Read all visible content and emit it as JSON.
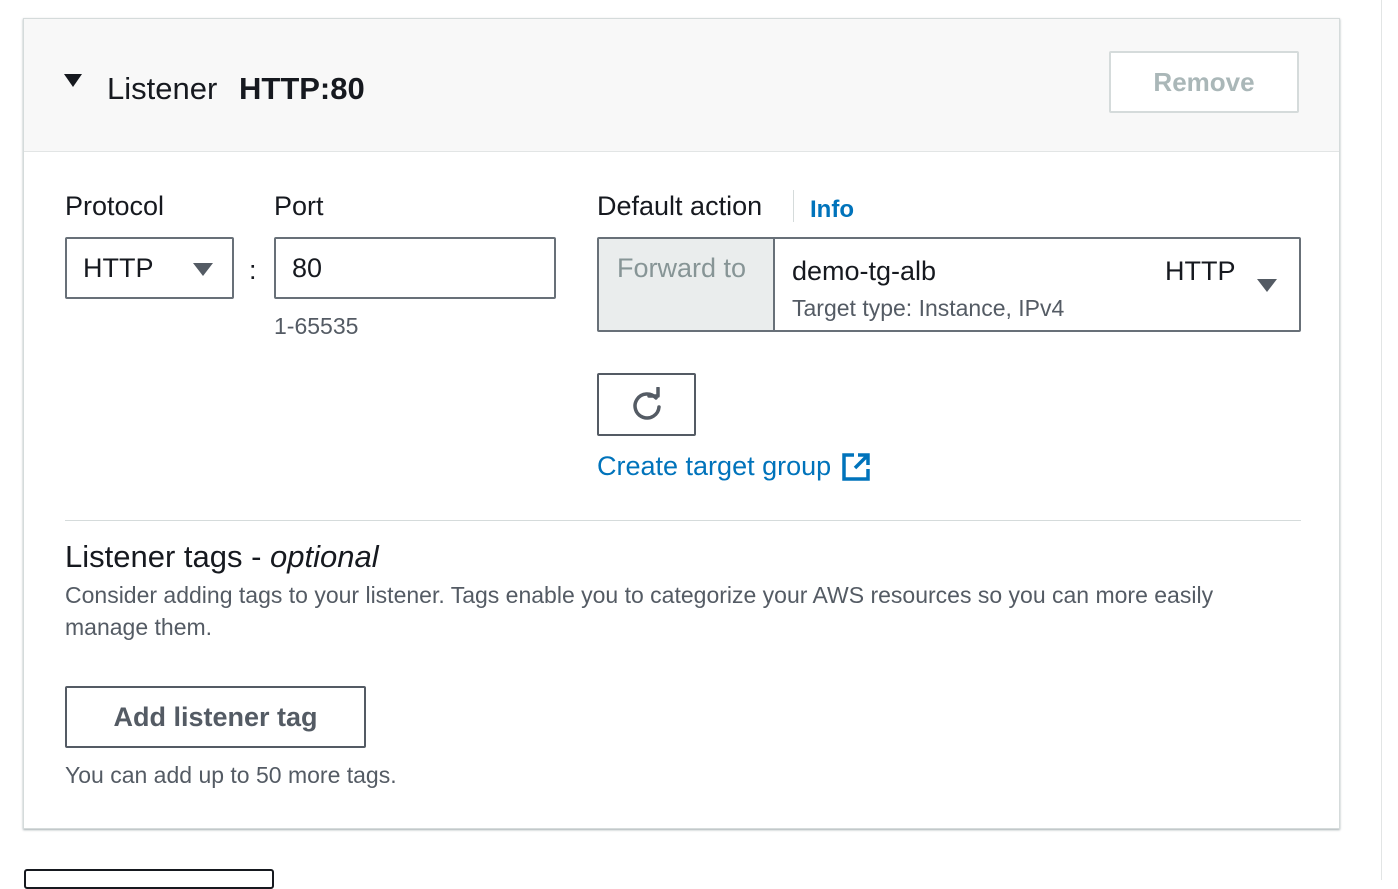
{
  "listener": {
    "label": "Listener",
    "value": "HTTP:80",
    "remove_label": "Remove"
  },
  "protocol": {
    "label": "Protocol",
    "value": "HTTP"
  },
  "port": {
    "label": "Port",
    "value": "80",
    "separator": ":",
    "hint": "1-65535"
  },
  "default_action": {
    "label": "Default action",
    "info_label": "Info",
    "forward_label": "Forward to",
    "target_group_name": "demo-tg-alb",
    "target_group_protocol": "HTTP",
    "target_group_desc": "Target type: Instance, IPv4",
    "create_link": "Create target group"
  },
  "tags": {
    "title": "Listener tags - ",
    "title_optional": "optional",
    "description": "Consider adding tags to your listener. Tags enable you to categorize your AWS resources so you can more easily manage them.",
    "add_label": "Add listener tag",
    "hint": "You can add up to 50 more tags."
  },
  "colors": {
    "link": "#0073bb",
    "border": "#687078",
    "disabled_text": "#aab7b8"
  },
  "icons": {
    "collapse": "caret-down-icon",
    "dropdown": "triangle-down-icon",
    "refresh": "refresh-icon",
    "external": "external-link-icon"
  }
}
